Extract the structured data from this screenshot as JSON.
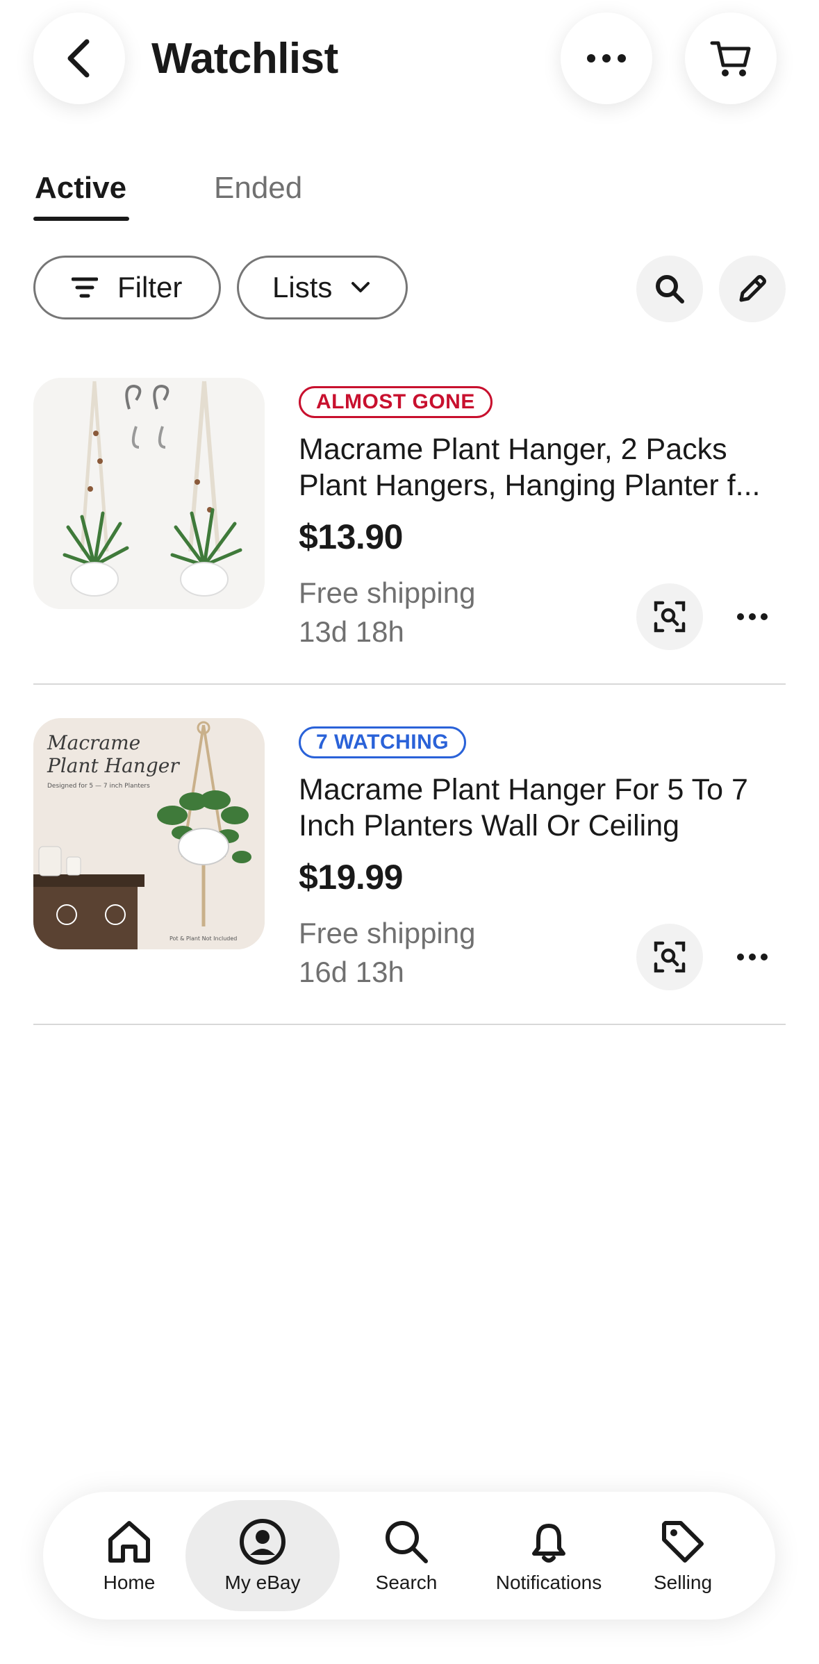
{
  "header": {
    "title": "Watchlist"
  },
  "tabs": [
    {
      "label": "Active",
      "selected": true
    },
    {
      "label": "Ended",
      "selected": false
    }
  ],
  "filters": {
    "filter_label": "Filter",
    "lists_label": "Lists"
  },
  "items": [
    {
      "badge": "ALMOST GONE",
      "badge_color": "#c8102e",
      "title_line1": "Macrame Plant Hanger, 2 Packs",
      "title_line2": "Plant Hangers, Hanging Planter f...",
      "price": "$13.90",
      "shipping": "Free shipping",
      "time_left": "13d 18h"
    },
    {
      "badge": "7 WATCHING",
      "badge_color": "#2a62d8",
      "title_line1": "Macrame Plant Hanger For 5 To 7",
      "title_line2": "Inch Planters Wall Or Ceiling",
      "price": "$19.99",
      "shipping": "Free shipping",
      "time_left": "16d 13h",
      "thumb_text": {
        "heading1": "Macrame",
        "heading2": "Plant Hanger",
        "sub": "Designed for 5 — 7 inch Planters",
        "note": "Pot & Plant Not Included"
      }
    }
  ],
  "nav": [
    {
      "label": "Home",
      "icon": "home-icon"
    },
    {
      "label": "My eBay",
      "icon": "account-icon",
      "selected": true
    },
    {
      "label": "Search",
      "icon": "search-icon"
    },
    {
      "label": "Notifications",
      "icon": "bell-icon"
    },
    {
      "label": "Selling",
      "icon": "tag-icon"
    }
  ]
}
